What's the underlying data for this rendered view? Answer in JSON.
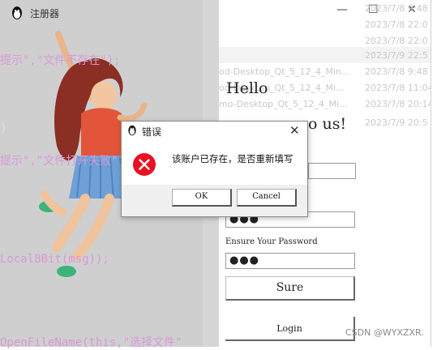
{
  "ide": {
    "lines": [
      "提示\",\"文件不存在\");",
      ")",
      "提示\",\"文件打开失败\")",
      "Local8Bit(msg));",
      "OpenFileName(this,\"选择文件\""
    ]
  },
  "window": {
    "title": "注册器",
    "minimize_glyph": "—",
    "maximize_glyph": "☐",
    "close_glyph": "✕"
  },
  "file_list": {
    "rows": [
      {
        "name": "",
        "date": "2023/7/8 9:48"
      },
      {
        "name": "",
        "date": "2023/7/8 22:0"
      },
      {
        "name": "",
        "date": "2023/7/8 22:0"
      },
      {
        "name": "",
        "date": "2023/7/9 22:5"
      },
      {
        "name": "od-Desktop_Qt_5_12_4_Min...",
        "date": "2023/7/8 9:48"
      },
      {
        "name": "od-Desktop_Qt_5_12_4_Mi...",
        "date": "2023/7/8 11:04"
      },
      {
        "name": "mo-Desktop_Qt_5_12_4_Mi...",
        "date": "2023/7/8 20:14"
      },
      {
        "name": "",
        "date": "2023/7/9 20:5"
      }
    ]
  },
  "form": {
    "hello": "Hello",
    "welcome": "o us!",
    "password_value": "●●●",
    "confirm_label": "Ensure Your Password",
    "confirm_value": "●●●",
    "sure_button": "Sure",
    "login_button": "Login"
  },
  "dialog": {
    "title": "错误",
    "close_glyph": "✕",
    "message": "该账户已存在，是否重新填写",
    "ok_button": "OK",
    "cancel_button": "Cancel"
  },
  "watermark": "CSDN @WYXZXR.",
  "colors": {
    "error_red": "#e81123",
    "code_pink": "#d79ad7"
  }
}
